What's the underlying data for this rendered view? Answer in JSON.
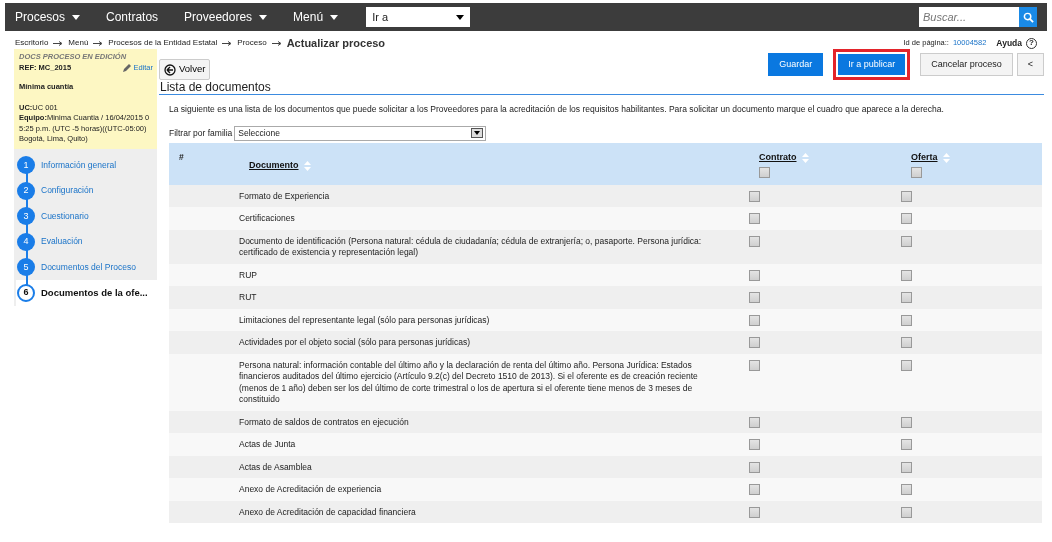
{
  "navbar": {
    "menus": [
      {
        "label": "Procesos",
        "dropdown": true
      },
      {
        "label": "Contratos",
        "dropdown": false
      },
      {
        "label": "Proveedores",
        "dropdown": true
      },
      {
        "label": "Menú",
        "dropdown": true
      }
    ],
    "goto": {
      "value": "Ir a"
    },
    "search": {
      "placeholder": "Buscar..."
    }
  },
  "breadcrumb": {
    "links": [
      "Escritorio",
      "Menú",
      "Procesos de la Entidad Estatal",
      "Proceso"
    ],
    "current": "Actualizar proceso"
  },
  "page_id": {
    "label": "Id de página::",
    "value": "10004582"
  },
  "help": "Ayuda",
  "help_icon": "?",
  "sidebar": {
    "status": "DOCS PROCESO EN EDICIÓN",
    "ref": "REF: MC_2015",
    "edit": "Editar",
    "modality": "Mínima cuantía",
    "uc_label": "UC:",
    "uc": "UC 001",
    "team_label": "Equipo:",
    "team": "Minima Cuantia / 16/04/2015 05:25 p.m. (UTC -5 horas)((UTC-05:00) Bogotá, Lima, Quito)",
    "steps": [
      {
        "number": "1",
        "label": "Información general",
        "selected": false
      },
      {
        "number": "2",
        "label": "Configuración",
        "selected": false
      },
      {
        "number": "3",
        "label": "Cuestionario",
        "selected": false
      },
      {
        "number": "4",
        "label": "Evaluación",
        "selected": false
      },
      {
        "number": "5",
        "label": "Documentos del Proceso",
        "selected": false
      },
      {
        "number": "6",
        "label": "Documentos de la ofe...",
        "selected": true
      }
    ]
  },
  "back_button": "Volver",
  "actions": [
    {
      "label": "Guardar",
      "kind": "primary",
      "highlighted": false
    },
    {
      "label": "Ir a publicar",
      "kind": "primary",
      "highlighted": true
    },
    {
      "label": "Cancelar proceso",
      "kind": "secondary",
      "highlighted": false
    },
    {
      "label": "<",
      "kind": "secondary",
      "highlighted": false
    }
  ],
  "section_title": "Lista de documentos",
  "intro": "La siguiente es una lista de los documentos que puede solicitar a los Proveedores para la acreditación de los requisitos habilitantes. Para solicitar un documento marque el cuadro que aparece a la derecha.",
  "filter": {
    "label": "Filtrar por familia",
    "value": "Seleccione"
  },
  "table": {
    "columns": [
      "#",
      "Documento",
      "Contrato",
      "Oferta"
    ],
    "header_checks": {
      "contrato": false,
      "oferta": false
    },
    "rows": [
      {
        "document": "Formato de Experiencia",
        "contrato": false,
        "oferta": false
      },
      {
        "document": "Certificaciones",
        "contrato": false,
        "oferta": false
      },
      {
        "document": "Documento de identificación (Persona natural: cédula de ciudadanía; cédula de extranjería; o, pasaporte. Persona jurídica: certificado de existencia y representación legal)",
        "contrato": false,
        "oferta": false
      },
      {
        "document": "RUP",
        "contrato": false,
        "oferta": false
      },
      {
        "document": "RUT",
        "contrato": false,
        "oferta": false
      },
      {
        "document": "Limitaciones del representante legal (sólo para personas jurídicas)",
        "contrato": false,
        "oferta": false
      },
      {
        "document": "Actividades por el objeto social (sólo para personas jurídicas)",
        "contrato": false,
        "oferta": false
      },
      {
        "document": "Persona natural: información contable del último año y la declaración de renta del último año. Persona Jurídica: Estados financieros auditados del último ejercicio (Artículo 9.2(c) del Decreto 1510 de 2013). Si el oferente es de creación reciente (menos de 1 año) deben ser los del último de corte trimestral o los de apertura si el oferente tiene menos de 3 meses de constituido",
        "contrato": false,
        "oferta": false
      },
      {
        "document": "Formato de saldos de contratos en ejecución",
        "contrato": false,
        "oferta": false
      },
      {
        "document": "Actas de Junta",
        "contrato": false,
        "oferta": false
      },
      {
        "document": "Actas de Asamblea",
        "contrato": false,
        "oferta": false
      },
      {
        "document": "Anexo de Acreditación de experiencia",
        "contrato": false,
        "oferta": false
      },
      {
        "document": "Anexo de Acreditación de capacidad financiera",
        "contrato": false,
        "oferta": false
      }
    ]
  }
}
